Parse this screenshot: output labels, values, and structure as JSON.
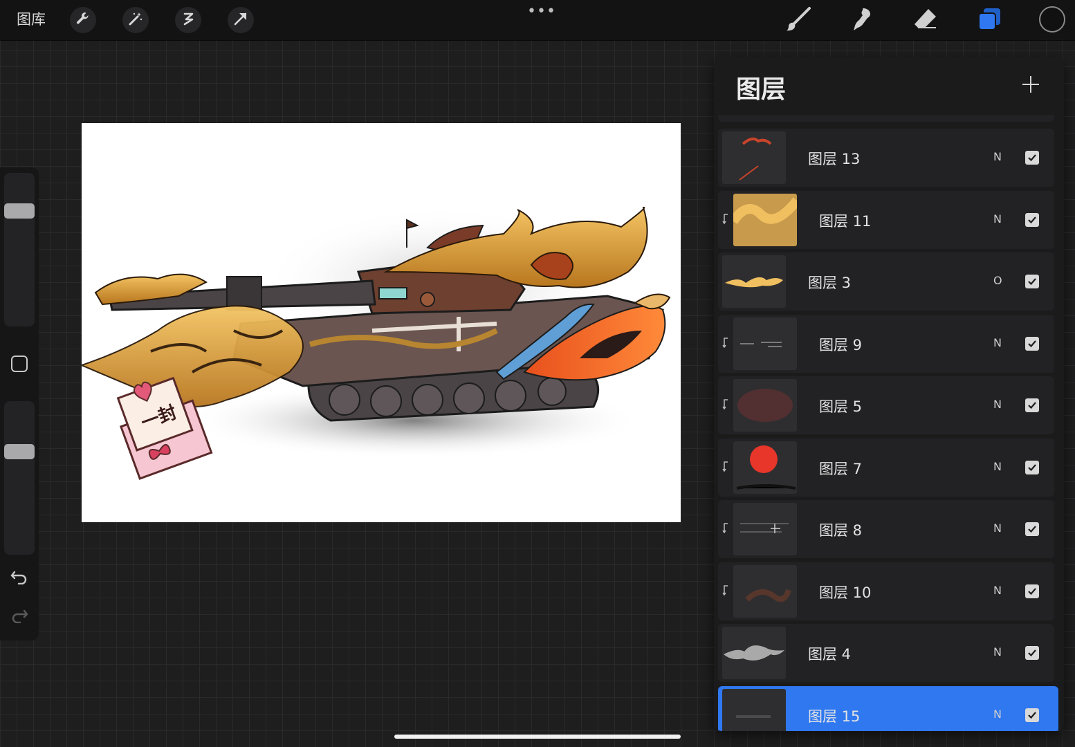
{
  "toolbar": {
    "gallery_label": "图库",
    "more_dots": "•••",
    "left_tools": [
      "wrench-icon",
      "magic-wand-icon",
      "selection-icon",
      "transform-arrow-icon"
    ],
    "right_tools": [
      "brush-icon",
      "smudge-icon",
      "eraser-icon",
      "layers-icon"
    ],
    "active_tool": "layers-icon",
    "accent_color": "#2f78f0",
    "current_color": "#111111"
  },
  "sidebar": {
    "brush_size_level": 0.25,
    "opacity_level": 0.33
  },
  "layers_panel": {
    "title": "图层",
    "layers": [
      {
        "name": "图层 13",
        "blend": "N",
        "visible": true,
        "clipped": false,
        "selected": false
      },
      {
        "name": "图层 11",
        "blend": "N",
        "visible": true,
        "clipped": true,
        "selected": false
      },
      {
        "name": "图层 3",
        "blend": "O",
        "visible": true,
        "clipped": false,
        "selected": false
      },
      {
        "name": "图层 9",
        "blend": "N",
        "visible": true,
        "clipped": true,
        "selected": false
      },
      {
        "name": "图层 5",
        "blend": "N",
        "visible": true,
        "clipped": true,
        "selected": false
      },
      {
        "name": "图层 7",
        "blend": "N",
        "visible": true,
        "clipped": true,
        "selected": false
      },
      {
        "name": "图层 8",
        "blend": "N",
        "visible": true,
        "clipped": true,
        "selected": false
      },
      {
        "name": "图层 10",
        "blend": "N",
        "visible": true,
        "clipped": true,
        "selected": false
      },
      {
        "name": "图层 4",
        "blend": "N",
        "visible": true,
        "clipped": false,
        "selected": false
      },
      {
        "name": "图层 15",
        "blend": "N",
        "visible": true,
        "clipped": false,
        "selected": true
      }
    ]
  },
  "canvas": {
    "sticker_text": "一封"
  }
}
